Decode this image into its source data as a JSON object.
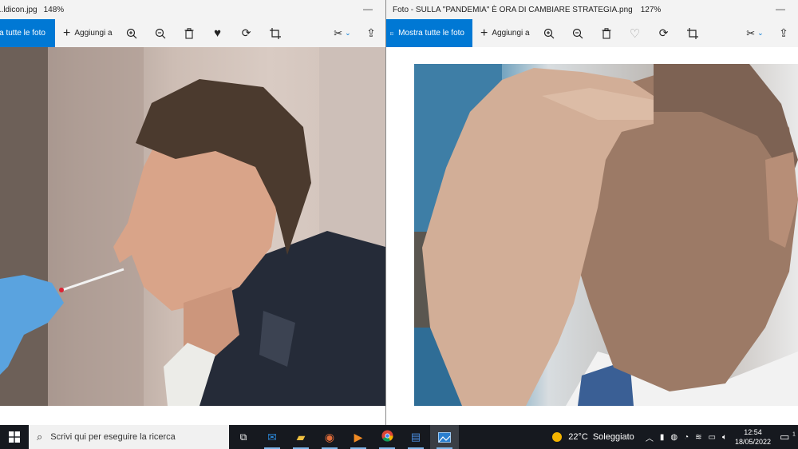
{
  "window_left": {
    "title": "...ldicon.jpg",
    "zoom": "148%",
    "toolbar": {
      "show_all_label": "stra tutte le foto",
      "add_label": "Aggiungi a"
    }
  },
  "window_right": {
    "title": "Foto - SULLA \"PANDEMIA\" È ORA DI CAMBIARE STRATEGIA.png",
    "zoom": "127%",
    "toolbar": {
      "show_all_label": "Mostra tutte le foto",
      "add_label": "Aggiungi a"
    }
  },
  "taskbar": {
    "search_placeholder": "Scrivi qui per eseguire la ricerca",
    "weather_temp": "22°C",
    "weather_desc": "Soleggiato",
    "time": "12:54",
    "date": "18/05/2022",
    "notification_count": "1"
  }
}
